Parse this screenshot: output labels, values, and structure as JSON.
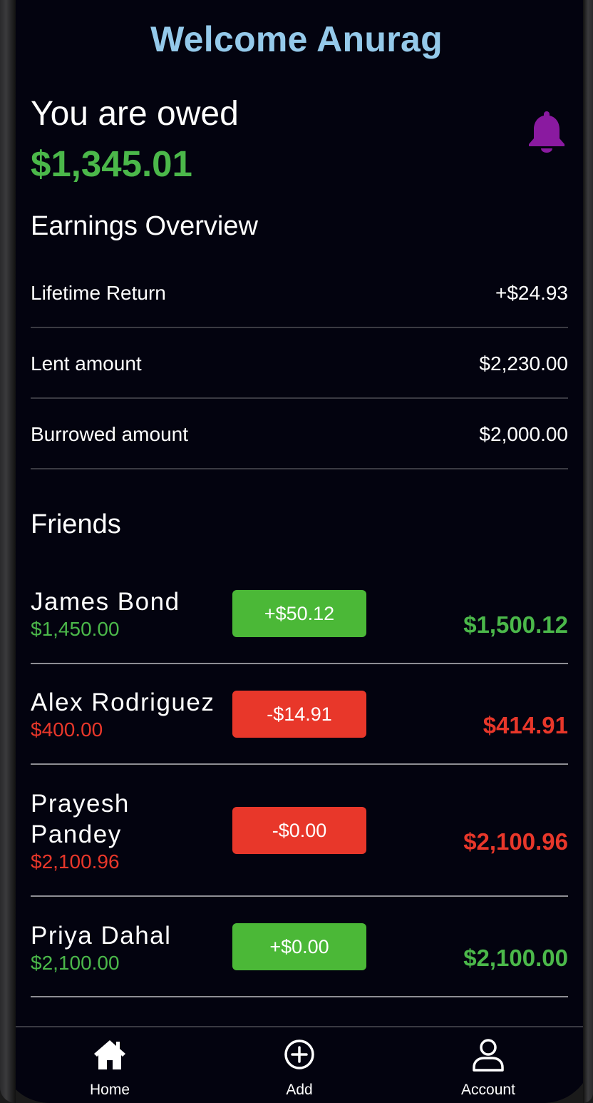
{
  "header": {
    "welcome": "Welcome Anurag"
  },
  "summary": {
    "owed_label": "You are owed",
    "owed_amount": "$1,345.01",
    "owed_color": "#4bb84a",
    "notification_icon": "bell-icon"
  },
  "earnings": {
    "title": "Earnings Overview",
    "rows": [
      {
        "label": "Lifetime Return",
        "value": "+$24.93"
      },
      {
        "label": "Lent amount",
        "value": "$2,230.00"
      },
      {
        "label": "Burrowed amount",
        "value": "$2,000.00"
      }
    ]
  },
  "friends": {
    "title": "Friends",
    "items": [
      {
        "name": "James Bond",
        "balance": "$1,450.00",
        "change": "+$50.12",
        "total": "$1,500.12",
        "status": "positive"
      },
      {
        "name": "Alex Rodriguez",
        "balance": "$400.00",
        "change": "-$14.91",
        "total": "$414.91",
        "status": "negative"
      },
      {
        "name": "Prayesh Pandey",
        "balance": "$2,100.96",
        "change": "-$0.00",
        "total": "$2,100.96",
        "status": "negative"
      },
      {
        "name": "Priya Dahal",
        "balance": "$2,100.00",
        "change": "+$0.00",
        "total": "$2,100.00",
        "status": "positive"
      }
    ]
  },
  "tabbar": {
    "tabs": [
      {
        "label": "Home",
        "icon": "home-icon"
      },
      {
        "label": "Add",
        "icon": "plus-circle-icon"
      },
      {
        "label": "Account",
        "icon": "user-icon"
      }
    ]
  },
  "colors": {
    "background": "#03030f",
    "accent_title": "#94c9ea",
    "positive": "#4bb84a",
    "negative": "#e8372a",
    "bell": "#8a1aa0"
  }
}
